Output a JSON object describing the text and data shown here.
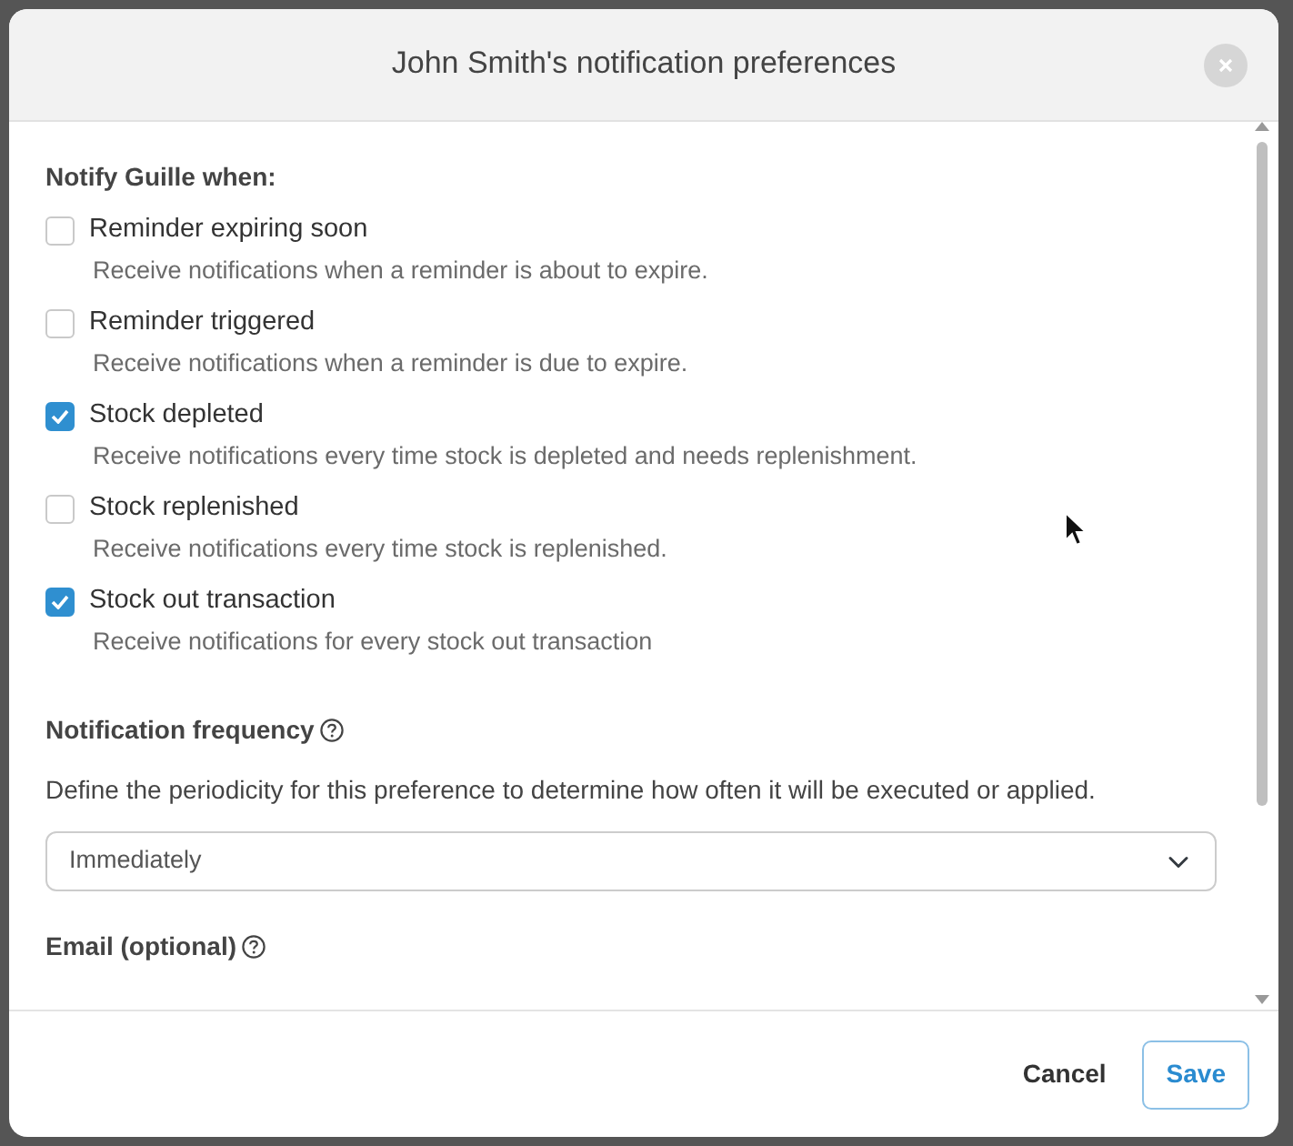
{
  "dialog": {
    "title": "John Smith's notification preferences"
  },
  "notify": {
    "heading": "Notify Guille when:",
    "options": [
      {
        "label": "Reminder expiring soon",
        "description": "Receive notifications when a reminder is about to expire.",
        "checked": false
      },
      {
        "label": "Reminder triggered",
        "description": "Receive notifications when a reminder is due to expire.",
        "checked": false
      },
      {
        "label": "Stock depleted",
        "description": "Receive notifications every time stock is depleted and needs replenishment.",
        "checked": true
      },
      {
        "label": "Stock replenished",
        "description": "Receive notifications every time stock is replenished.",
        "checked": false
      },
      {
        "label": "Stock out transaction",
        "description": "Receive notifications for every stock out transaction",
        "checked": true
      }
    ]
  },
  "frequency": {
    "label": "Notification frequency",
    "description": "Define the periodicity for this preference to determine how often it will be executed or applied.",
    "value": "Immediately"
  },
  "email": {
    "label": "Email (optional)"
  },
  "buttons": [
    {
      "label": "Cancel",
      "kind": "link"
    },
    {
      "label": "Save",
      "kind": "outline"
    }
  ]
}
